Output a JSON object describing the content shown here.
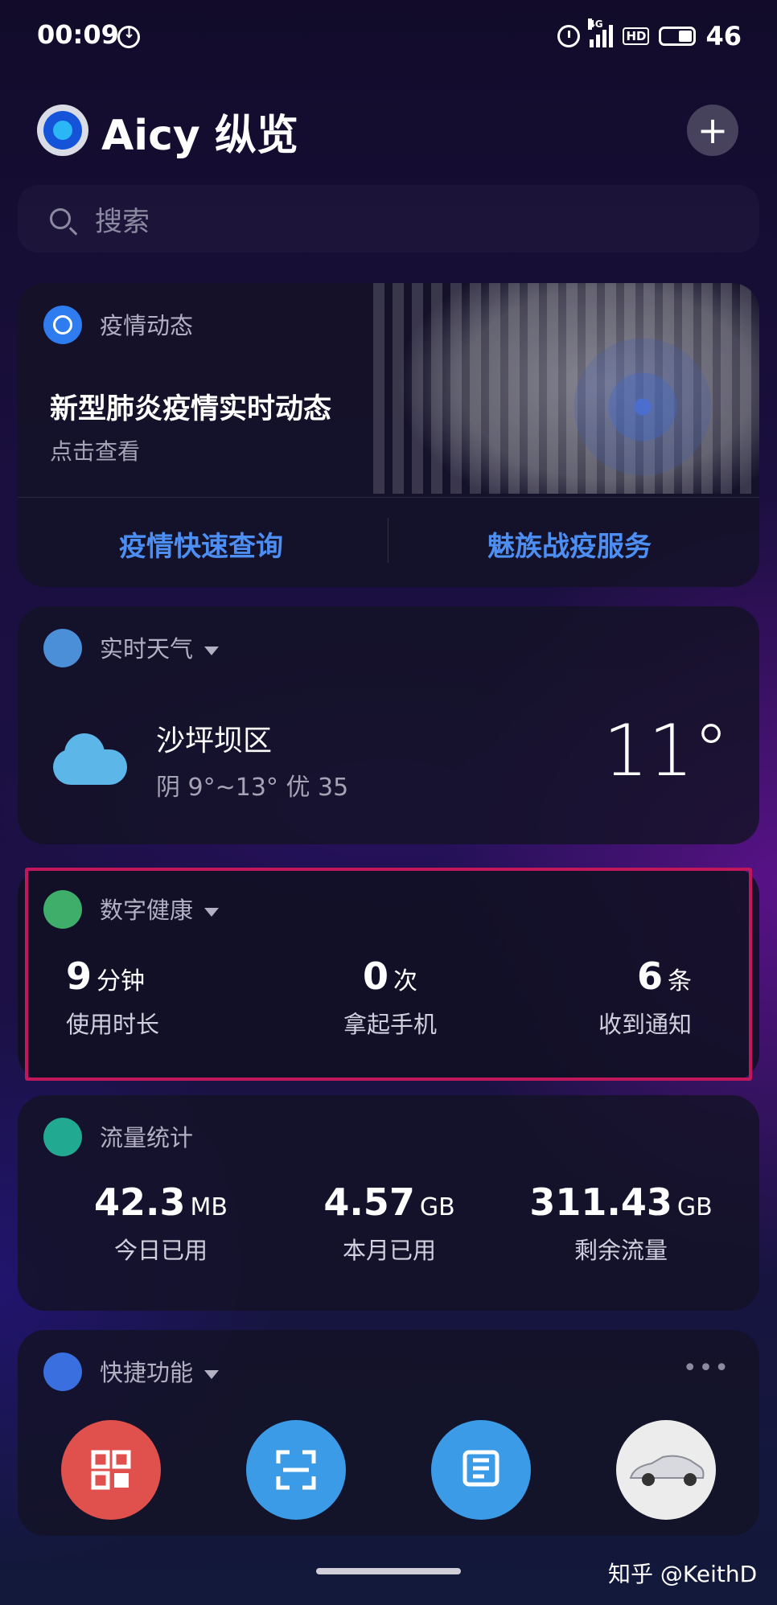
{
  "status_bar": {
    "time": "00:09",
    "network": "4G",
    "hd": "HD",
    "battery": "46"
  },
  "header": {
    "title": "Aicy 纵览"
  },
  "search": {
    "placeholder": "搜索"
  },
  "epidemic": {
    "title": "疫情动态",
    "headline": "新型肺炎疫情实时动态",
    "subtitle": "点击查看",
    "link_left": "疫情快速查询",
    "link_right": "魅族战疫服务"
  },
  "weather": {
    "title": "实时天气",
    "location": "沙坪坝区",
    "detail": "阴   9°~13°   优 35",
    "temperature": "11°"
  },
  "health": {
    "title": "数字健康",
    "stats": [
      {
        "value": "9",
        "unit": "分钟",
        "label": "使用时长"
      },
      {
        "value": "0",
        "unit": "次",
        "label": "拿起手机"
      },
      {
        "value": "6",
        "unit": "条",
        "label": "收到通知"
      }
    ]
  },
  "traffic": {
    "title": "流量统计",
    "stats": [
      {
        "value": "42.3",
        "unit": "MB",
        "label": "今日已用"
      },
      {
        "value": "4.57",
        "unit": "GB",
        "label": "本月已用"
      },
      {
        "value": "311.43",
        "unit": "GB",
        "label": "剩余流量"
      }
    ]
  },
  "shortcuts": {
    "title": "快捷功能",
    "more": "•••",
    "colors": [
      "#e0504c",
      "#3b9be6",
      "#3b9be6",
      "#ececec"
    ]
  },
  "watermark": "知乎 @KeithD"
}
